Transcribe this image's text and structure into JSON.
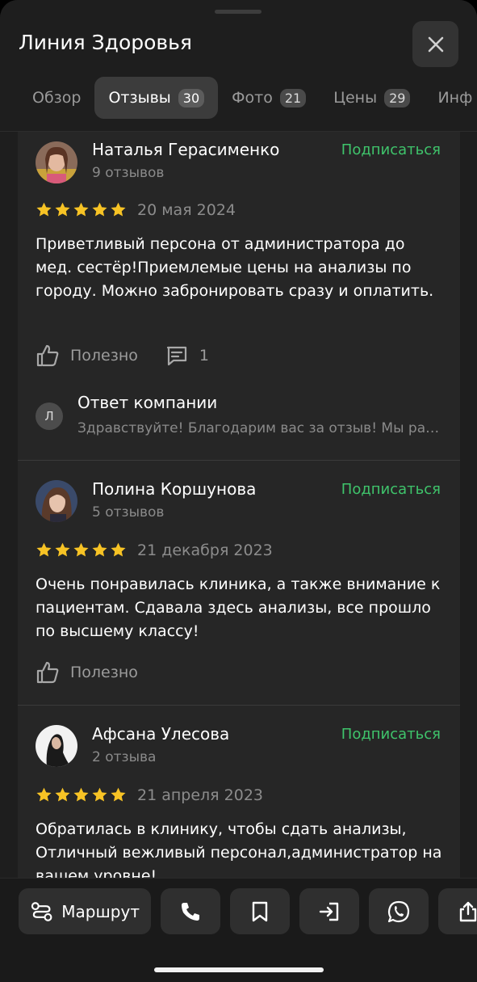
{
  "header": {
    "title": "Линия Здоровья",
    "tabs": [
      {
        "label": "Обзор",
        "count": null
      },
      {
        "label": "Отзывы",
        "count": "30"
      },
      {
        "label": "Фото",
        "count": "21"
      },
      {
        "label": "Цены",
        "count": "29"
      },
      {
        "label": "Инф",
        "count": null
      }
    ]
  },
  "reviews": [
    {
      "author": "Наталья Герасименко",
      "reviews_count": "9 отзывов",
      "subscribe": "Подписаться",
      "rating": 5,
      "date": "20 мая 2024",
      "text": "Приветливый персона от администратора до мед. сестёр!Приемлемые цены на анализы по городу. Можно забронировать сразу и оплатить.",
      "useful_label": "Полезно",
      "comments_count": "1",
      "reply": {
        "avatar_letter": "Л",
        "title": "Ответ компании",
        "text": "Здравствуйте! Благодарим вас за отзыв! Мы рады, что вам понравилось"
      }
    },
    {
      "author": "Полина Коршунова",
      "reviews_count": "5 отзывов",
      "subscribe": "Подписаться",
      "rating": 5,
      "date": "21 декабря 2023",
      "text": "Очень понравилась клиника, а также внимание к пациентам. Сдавала здесь анализы, все прошло по высшему классу!",
      "useful_label": "Полезно"
    },
    {
      "author": "Афсана Улесова",
      "reviews_count": "2 отзыва",
      "subscribe": "Подписаться",
      "rating": 5,
      "date": "21 апреля 2023",
      "text": "Обратилась в клинику, чтобы сдать анализы, Отличный вежливый персонал,администратор на вашем уровне!"
    }
  ],
  "bottom_bar": {
    "route_label": "Маршрут",
    "icons": [
      "phone-icon",
      "bookmark-icon",
      "login-icon",
      "whatsapp-icon",
      "share-icon"
    ]
  },
  "colors": {
    "accent_green": "#3fc46b",
    "star": "#f7c325",
    "background": "#1e1e1e",
    "card": "#262626"
  }
}
